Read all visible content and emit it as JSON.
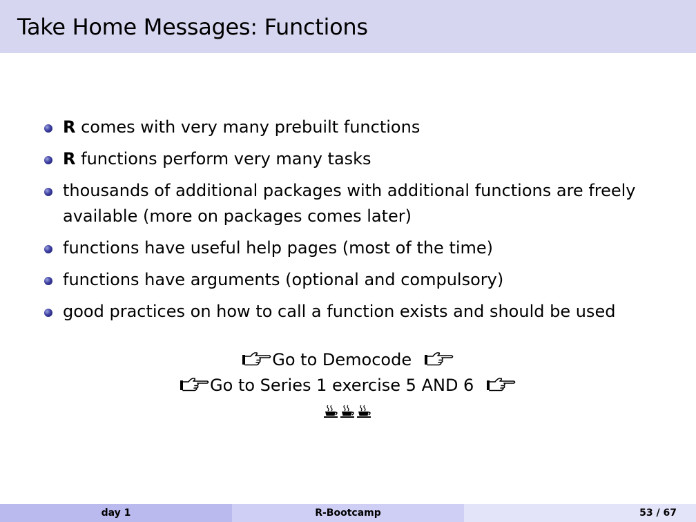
{
  "slide": {
    "title": "Take Home Messages: Functions"
  },
  "bullets": [
    {
      "bold": "R",
      "text": " comes with very many prebuilt functions"
    },
    {
      "bold": "R",
      "text": " functions perform very many tasks"
    },
    {
      "bold": "",
      "text": "thousands of additional packages with additional functions are freely available (more on packages comes later)"
    },
    {
      "bold": "",
      "text": "functions have useful help pages (most of the time)"
    },
    {
      "bold": "",
      "text": "functions have arguments (optional and compulsory)"
    },
    {
      "bold": "",
      "text": "good practices on how to call a function exists and should be used"
    }
  ],
  "links": {
    "democode": "Go to Democode",
    "series": "Go to Series 1 exercise 5 AND 6"
  },
  "icons": {
    "hand": "pointing-hand-icon",
    "coffee": "coffee-cup-icon"
  },
  "footer": {
    "left": "day 1",
    "center": "R-Bootcamp",
    "page": "53 / 67"
  },
  "colors": {
    "header_bg": "#d6d6f0",
    "footer_left": "#babaee",
    "footer_mid": "#cfcff5",
    "footer_right": "#e3e3fa",
    "bullet": "#3c3fa0"
  }
}
